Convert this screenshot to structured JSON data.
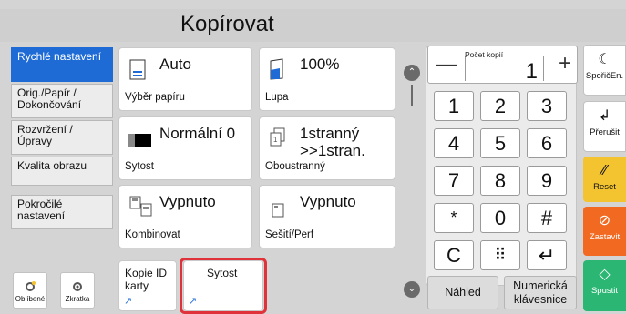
{
  "title": "Kopírovat",
  "nav": {
    "items": [
      {
        "label": "Rychlé nastavení",
        "active": true
      },
      {
        "label": "Orig./Papír / Dokončování",
        "active": false
      },
      {
        "label": "Rozvržení /Úpravy",
        "active": false
      },
      {
        "label": "Kvalita obrazu",
        "active": false
      },
      {
        "label": "Pokročilé nastavení",
        "active": false
      }
    ],
    "favorites_label": "Oblíbené",
    "shortcut_label": "Zkratka"
  },
  "tiles": {
    "paper": {
      "value": "Auto",
      "caption": "Výběr papíru"
    },
    "zoom": {
      "value": "100%",
      "caption": "Lupa"
    },
    "density": {
      "value": "Normální 0",
      "caption": "Sytost"
    },
    "duplex": {
      "value": "1stranný >>1stran.",
      "caption": "Oboustranný"
    },
    "combine": {
      "value": "Vypnuto",
      "caption": "Kombinovat"
    },
    "staple": {
      "value": "Vypnuto",
      "caption": "Sešití/Perf"
    },
    "id_copy": {
      "value": "Kopie ID karty"
    },
    "sytost_shortcut": {
      "value": "Sytost"
    }
  },
  "keypad": {
    "copies_caption": "Počet kopií",
    "copies_value": "1",
    "minus": "—",
    "plus": "+",
    "keys": [
      "1",
      "2",
      "3",
      "4",
      "5",
      "6",
      "7",
      "8",
      "9",
      "*",
      "0",
      "#"
    ],
    "clear": "C",
    "grid": "⠿",
    "enter": "↵",
    "preview_label": "Náhled",
    "numeric_keyboard_label": "Numerická klávesnice"
  },
  "side": {
    "sleep": "SpořičEn.",
    "interrupt": "Přerušit",
    "reset": "Reset",
    "stop": "Zastavit",
    "start": "Spustit"
  },
  "colors": {
    "nav_active": "#1e6bd6",
    "highlight": "#e0323b",
    "reset": "#f4c430",
    "stop": "#f26a21",
    "start": "#2bb673"
  }
}
